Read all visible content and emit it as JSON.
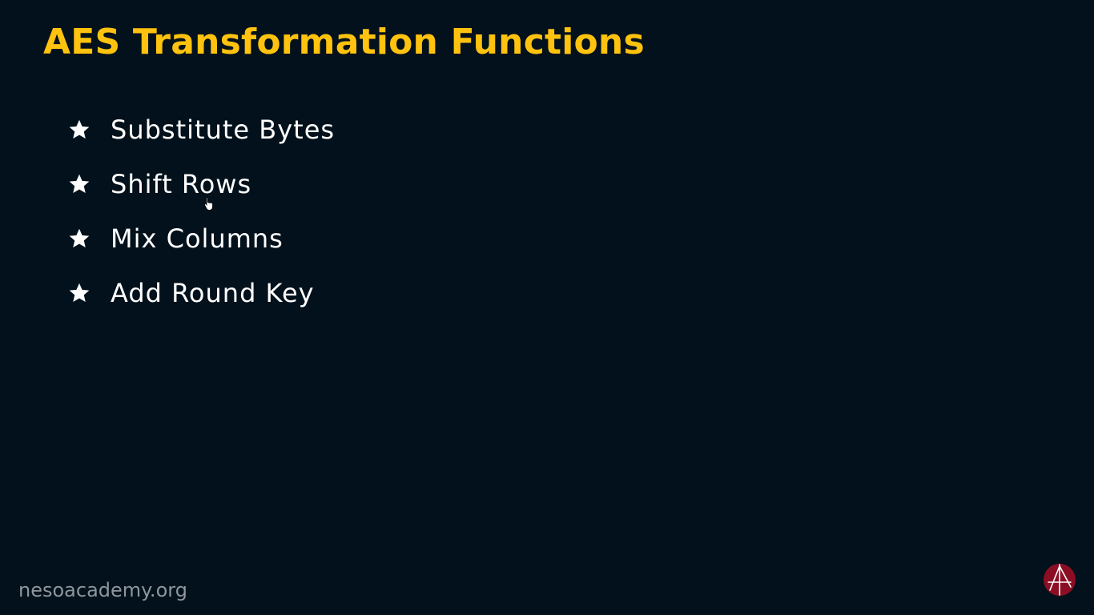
{
  "slide": {
    "title": "AES Transformation Functions",
    "bullets": [
      {
        "icon": "star-icon",
        "label": "Substitute Bytes"
      },
      {
        "icon": "star-icon",
        "label": "Shift Rows"
      },
      {
        "icon": "star-icon",
        "label": "Mix Columns"
      },
      {
        "icon": "star-icon",
        "label": "Add Round Key"
      }
    ],
    "watermark": "nesoacademy.org",
    "logo_icon": "neso-academy-logo",
    "cursor_icon": "hand-pointer-icon"
  },
  "colors": {
    "background": "#02111b",
    "title": "#ffc20e",
    "bullet_text": "#ffffff",
    "watermark": "#8d969c",
    "logo": "#8b0e25"
  }
}
